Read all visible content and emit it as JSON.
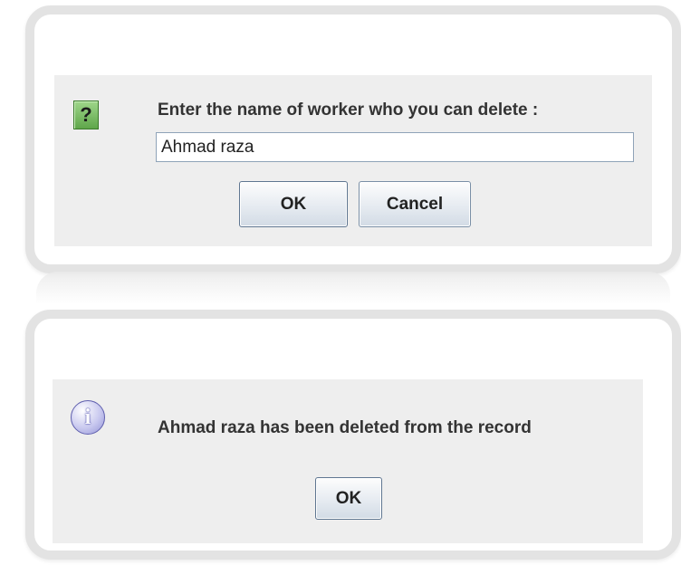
{
  "input_dialog": {
    "icon": "question-icon",
    "icon_glyph": "?",
    "prompt": "Enter the name of worker who you can delete :",
    "input_value": "Ahmad raza",
    "ok_label": "OK",
    "cancel_label": "Cancel"
  },
  "message_dialog": {
    "icon": "info-icon",
    "icon_glyph": "i",
    "message": "Ahmad raza has been deleted from the record",
    "ok_label": "OK"
  }
}
